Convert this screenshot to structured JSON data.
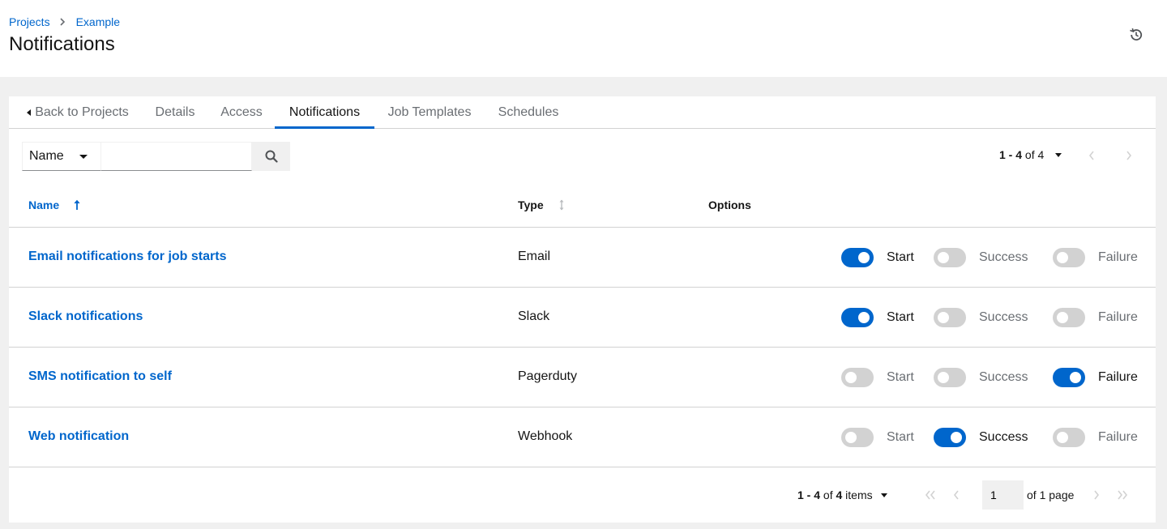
{
  "breadcrumb": {
    "items": [
      "Projects",
      "Example"
    ]
  },
  "header": {
    "title": "Notifications"
  },
  "tabs": [
    {
      "label": "Back to Projects"
    },
    {
      "label": "Details"
    },
    {
      "label": "Access"
    },
    {
      "label": "Notifications"
    },
    {
      "label": "Job Templates"
    },
    {
      "label": "Schedules"
    }
  ],
  "toolbar": {
    "filter_field": "Name",
    "search_value": "",
    "pager_prefix": "1 - 4",
    "pager_suffix": " of 4"
  },
  "table": {
    "columns": [
      "Name",
      "Type",
      "Options"
    ],
    "toggle_labels": [
      "Start",
      "Success",
      "Failure"
    ],
    "rows": [
      {
        "name": "Email notifications for job starts",
        "type": "Email",
        "start": true,
        "success": false,
        "failure": false
      },
      {
        "name": "Slack notifications",
        "type": "Slack",
        "start": true,
        "success": false,
        "failure": false
      },
      {
        "name": "SMS notification to self",
        "type": "Pagerduty",
        "start": false,
        "success": false,
        "failure": true
      },
      {
        "name": "Web notification",
        "type": "Webhook",
        "start": false,
        "success": true,
        "failure": false
      }
    ]
  },
  "footer": {
    "range": "1 - 4",
    "of_text": " of ",
    "total": "4",
    "items_text": " items",
    "page_value": "1",
    "of_pages": "of 1 page"
  },
  "colors": {
    "accent": "#0066cc",
    "toggle_off": "#d2d2d2",
    "border": "#d2d2d2",
    "page_bg": "#f0f0f0"
  },
  "icons": {
    "history": "history-icon",
    "search": "search-icon",
    "sort_asc": "sort-ascending-icon",
    "sort_neutral": "sort-icon",
    "prev": "angle-left-icon",
    "next": "angle-right-icon",
    "first": "angle-double-left-icon",
    "last": "angle-double-right-icon"
  }
}
